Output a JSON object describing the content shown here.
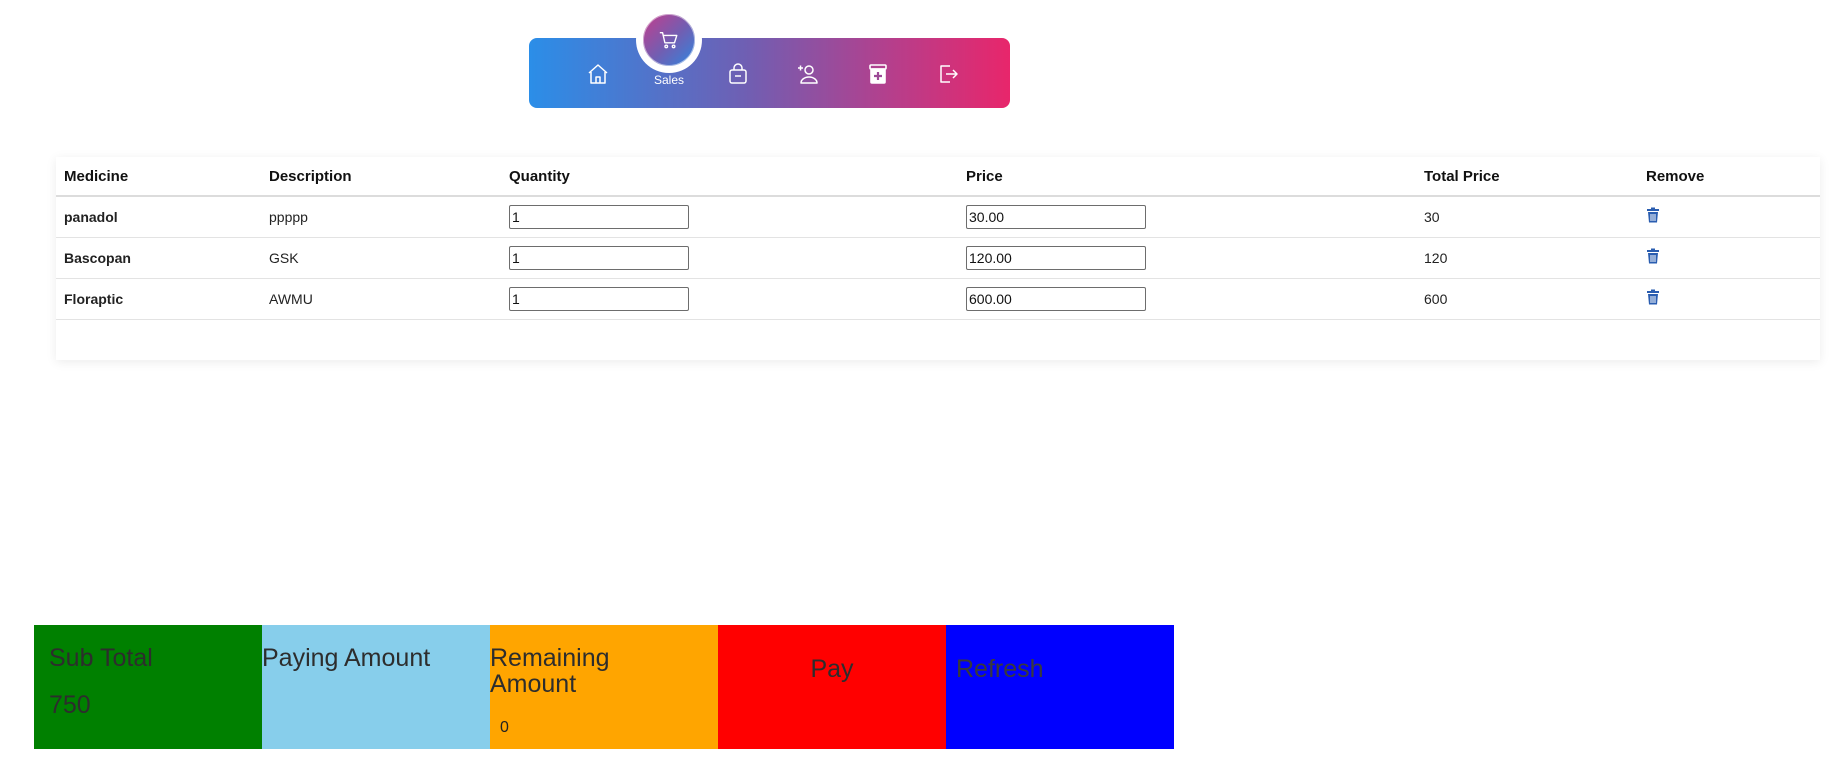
{
  "nav": {
    "items": [
      {
        "name": "home-icon"
      },
      {
        "name": "cart-icon",
        "label": "Sales",
        "active": true
      },
      {
        "name": "bag-icon"
      },
      {
        "name": "add-user-icon"
      },
      {
        "name": "medicine-icon"
      },
      {
        "name": "logout-icon"
      }
    ],
    "active_label": "Sales"
  },
  "table": {
    "headers": {
      "medicine": "Medicine",
      "description": "Description",
      "quantity": "Quantity",
      "price": "Price",
      "total_price": "Total Price",
      "remove": "Remove"
    },
    "rows": [
      {
        "medicine": "panadol",
        "description": "ppppp",
        "quantity": "1",
        "price": "30.00",
        "total_price": "30"
      },
      {
        "medicine": "Bascopan",
        "description": "GSK",
        "quantity": "1",
        "price": "120.00",
        "total_price": "120"
      },
      {
        "medicine": "Floraptic",
        "description": "AWMU",
        "quantity": "1",
        "price": "600.00",
        "total_price": "600"
      }
    ]
  },
  "summary": {
    "sub_total_label": "Sub Total",
    "sub_total_value": "750",
    "paying_amount_label": "Paying Amount",
    "remaining_amount_label": "Remaining Amount",
    "remaining_amount_value": "0",
    "pay_label": "Pay",
    "refresh_label": "Refresh"
  },
  "colors": {
    "nav_gradient_start": "#2b8ee8",
    "nav_gradient_end": "#e8266b",
    "sub_total_bg": "#008000",
    "paying_bg": "#87ceeb",
    "remaining_bg": "#ffa500",
    "pay_bg": "#ff0000",
    "refresh_bg": "#0000ff",
    "trash_icon": "#2a5db0"
  }
}
